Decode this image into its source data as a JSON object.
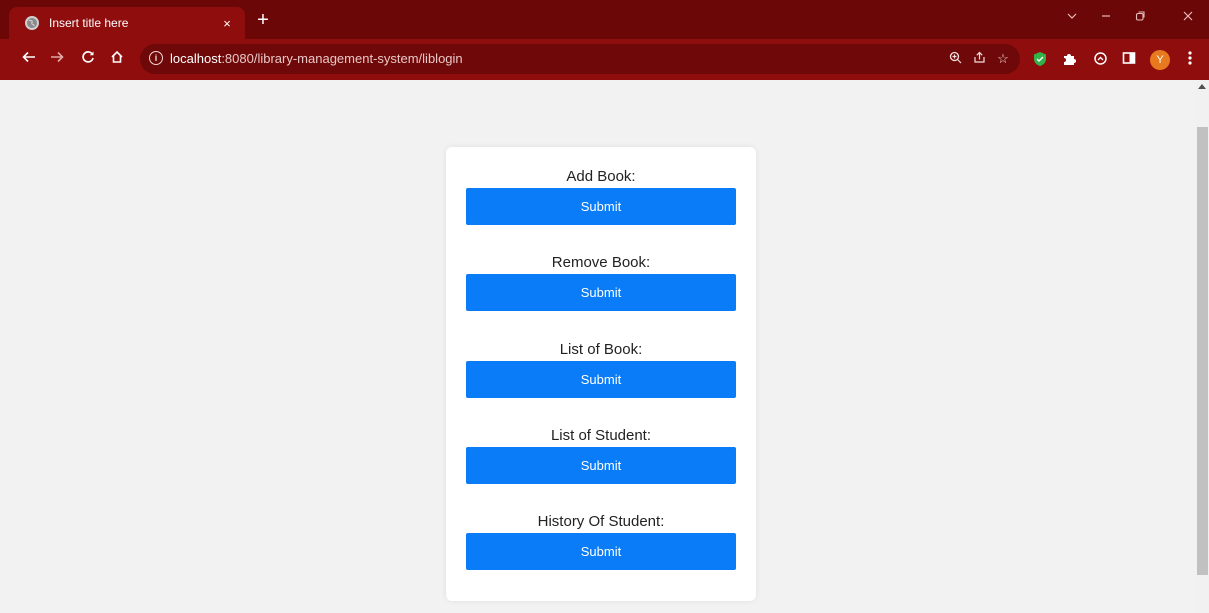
{
  "browser": {
    "tab_title": "Insert title here",
    "tab_close": "×",
    "new_tab": "+",
    "url_host": "localhost",
    "url_rest": ":8080/library-management-system/liblogin",
    "profile_initial": "Y"
  },
  "page": {
    "sections": [
      {
        "label": "Add Book:",
        "button": "Submit"
      },
      {
        "label": "Remove Book:",
        "button": "Submit"
      },
      {
        "label": "List of Book:",
        "button": "Submit"
      },
      {
        "label": "List of Student:",
        "button": "Submit"
      },
      {
        "label": "History Of Student:",
        "button": "Submit"
      }
    ]
  },
  "colors": {
    "tabbar": "#6b0707",
    "toolbar": "#8f0d0d",
    "button": "#0a7cf8",
    "page_bg": "#f2f2f2"
  },
  "icons": {
    "tab": "globe-icon",
    "nav": [
      "back-arrow-icon",
      "forward-arrow-icon",
      "reload-icon",
      "home-icon"
    ],
    "omnibox": [
      "info-icon",
      "zoom-icon",
      "share-icon",
      "bookmark-star-icon"
    ],
    "extensions": [
      "shield-extension-icon",
      "puzzle-icon",
      "sync-icon",
      "side-panel-icon"
    ],
    "window": [
      "chevron-down-icon",
      "minimize-icon",
      "restore-icon",
      "close-window-icon"
    ]
  }
}
